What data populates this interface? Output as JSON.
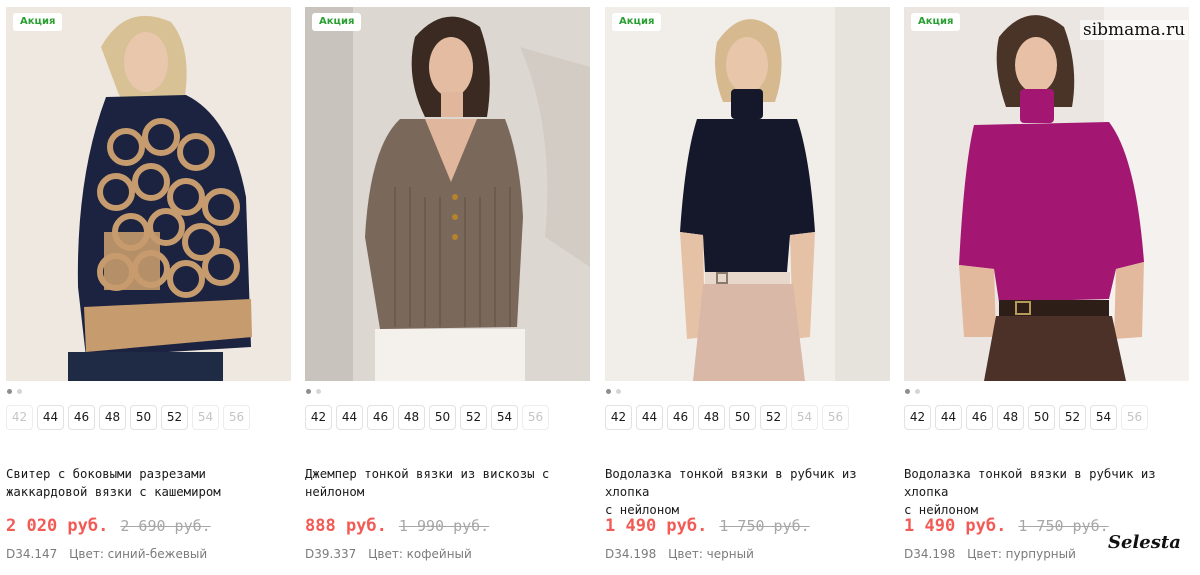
{
  "watermarks": {
    "site": "sibmama.ru",
    "brand": "Selesta"
  },
  "products": [
    {
      "badge": "Акция",
      "sizes": [
        {
          "label": "42",
          "available": false
        },
        {
          "label": "44",
          "available": true
        },
        {
          "label": "46",
          "available": true
        },
        {
          "label": "48",
          "available": true
        },
        {
          "label": "50",
          "available": true
        },
        {
          "label": "52",
          "available": true
        },
        {
          "label": "54",
          "available": false
        },
        {
          "label": "56",
          "available": false
        }
      ],
      "title_line1": "Свитер с боковыми разрезами",
      "title_line2": "жаккардовой вязки с кашемиром",
      "price": "2 020 руб.",
      "old_price": "2 690 руб.",
      "article": "D34.147",
      "color_text": "Цвет: синий-бежевый",
      "garment_color": "#1c2340"
    },
    {
      "badge": "Акция",
      "sizes": [
        {
          "label": "42",
          "available": true
        },
        {
          "label": "44",
          "available": true
        },
        {
          "label": "46",
          "available": true
        },
        {
          "label": "48",
          "available": true
        },
        {
          "label": "50",
          "available": true
        },
        {
          "label": "52",
          "available": true
        },
        {
          "label": "54",
          "available": true
        },
        {
          "label": "56",
          "available": false
        }
      ],
      "title_line1": "Джемпер тонкой вязки из вискозы с",
      "title_line2": "нейлоном",
      "price": "888 руб.",
      "old_price": "1 990 руб.",
      "article": "D39.337",
      "color_text": "Цвет: кофейный",
      "garment_color": "#7a685b"
    },
    {
      "badge": "Акция",
      "sizes": [
        {
          "label": "42",
          "available": true
        },
        {
          "label": "44",
          "available": true
        },
        {
          "label": "46",
          "available": true
        },
        {
          "label": "48",
          "available": true
        },
        {
          "label": "50",
          "available": true
        },
        {
          "label": "52",
          "available": true
        },
        {
          "label": "54",
          "available": false
        },
        {
          "label": "56",
          "available": false
        }
      ],
      "title_line1": "Водолазка тонкой вязки в рубчик из хлопка",
      "title_line2": "с нейлоном",
      "price": "1 490 руб.",
      "old_price": "1 750 руб.",
      "article": "D34.198",
      "color_text": "Цвет: черный",
      "garment_color": "#14182a"
    },
    {
      "badge": "Акция",
      "sizes": [
        {
          "label": "42",
          "available": true
        },
        {
          "label": "44",
          "available": true
        },
        {
          "label": "46",
          "available": true
        },
        {
          "label": "48",
          "available": true
        },
        {
          "label": "50",
          "available": true
        },
        {
          "label": "52",
          "available": true
        },
        {
          "label": "54",
          "available": true
        },
        {
          "label": "56",
          "available": false
        }
      ],
      "title_line1": "Водолазка тонкой вязки в рубчик из хлопка",
      "title_line2": "с нейлоном",
      "price": "1 490 руб.",
      "old_price": "1 750 руб.",
      "article": "D34.198",
      "color_text": "Цвет: пурпурный",
      "garment_color": "#a31773"
    }
  ]
}
